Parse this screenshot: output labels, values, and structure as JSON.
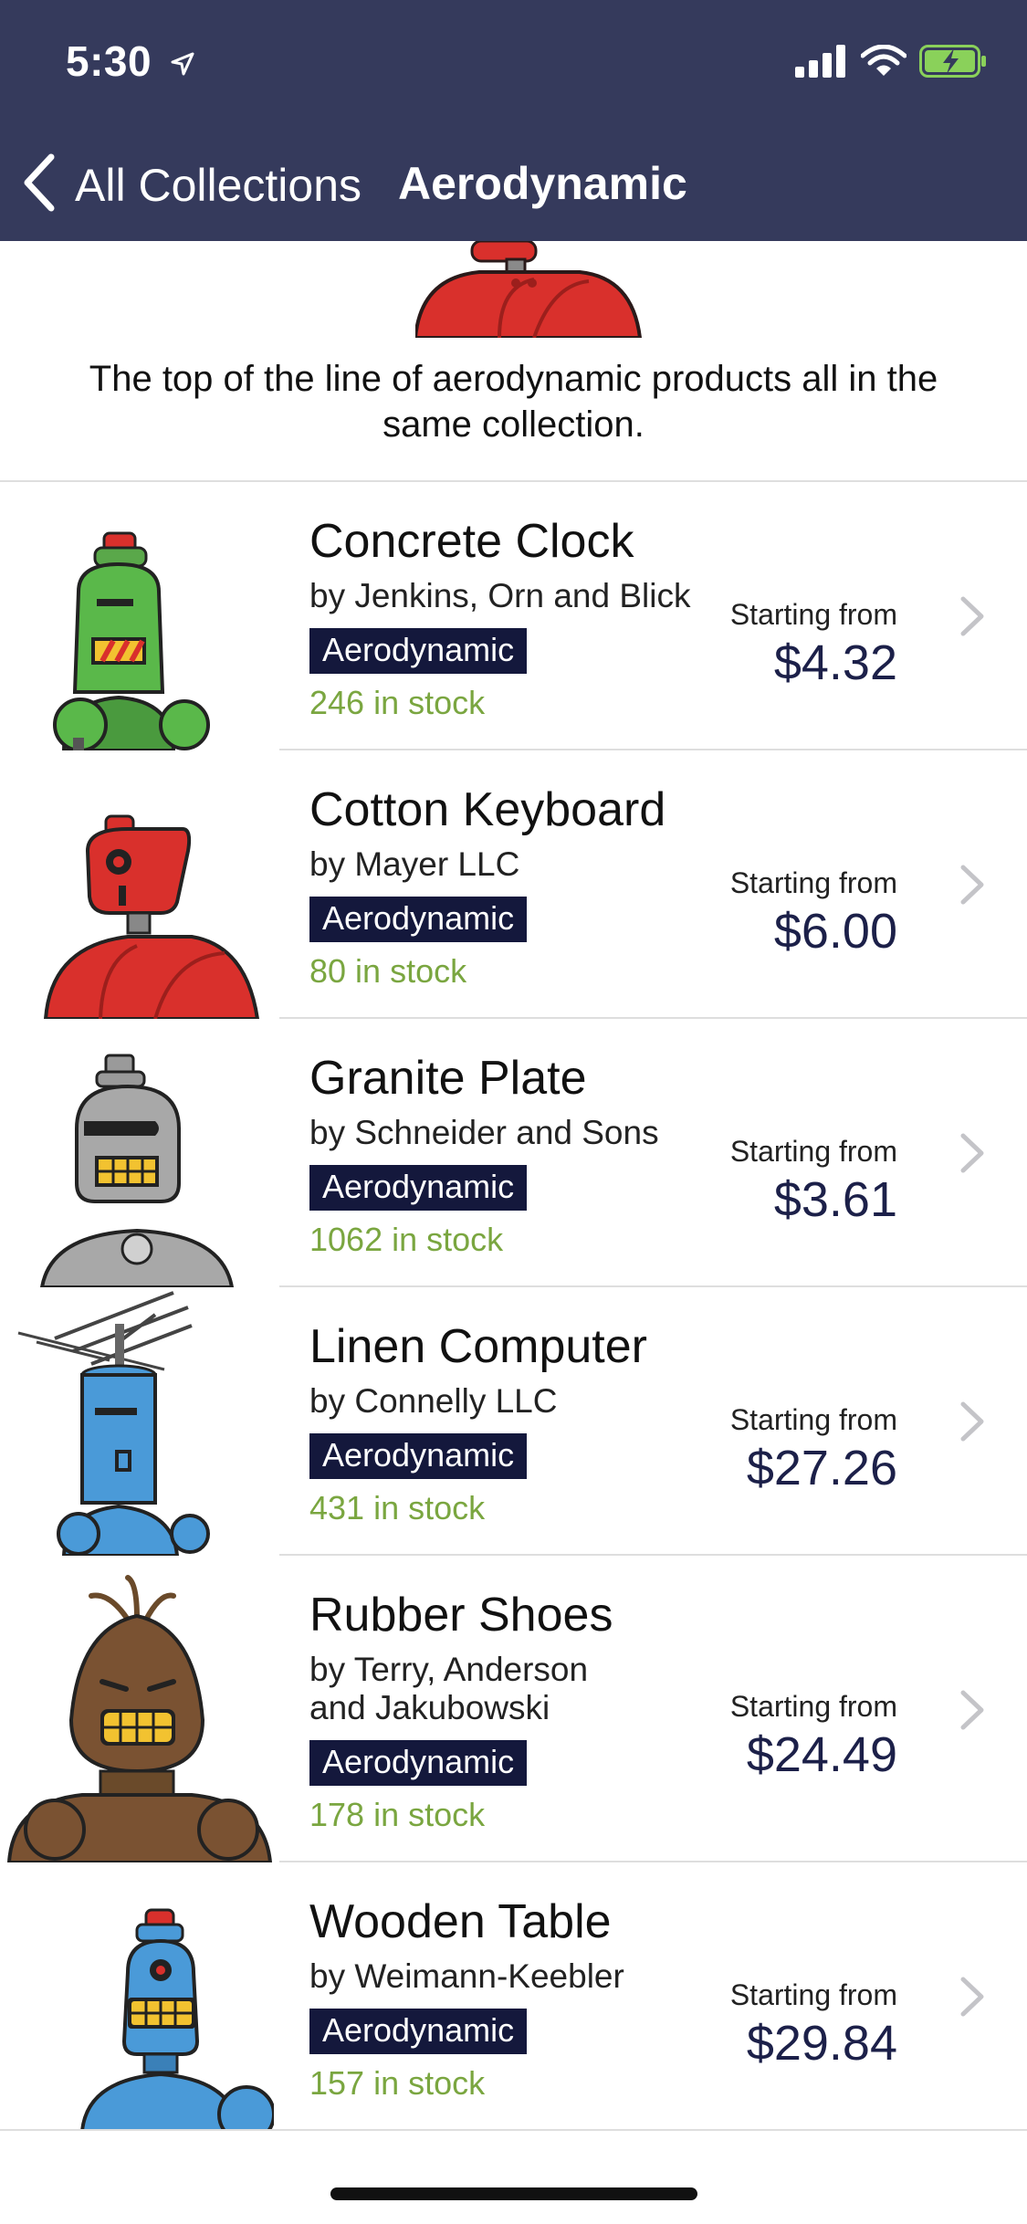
{
  "status_bar": {
    "time": "5:30",
    "icons": [
      "location-arrow-icon",
      "cellular-signal-icon",
      "wifi-icon",
      "battery-charging-icon"
    ]
  },
  "nav": {
    "back_label": "All Collections",
    "title": "Aerodynamic"
  },
  "collection": {
    "description": "The top of the line of aerodynamic products all in the same collection."
  },
  "colors": {
    "nav_background": "#353a5c",
    "tag_background": "#14183c",
    "stock_text": "#7aa640",
    "price_text": "#1c2049"
  },
  "products": [
    {
      "name": "Concrete Clock",
      "vendor": "by Jenkins, Orn and Blick",
      "tag": "Aerodynamic",
      "stock": "246 in stock",
      "price_label": "Starting from",
      "price": "$4.32",
      "robot_color": "green"
    },
    {
      "name": "Cotton Keyboard",
      "vendor": "by Mayer LLC",
      "tag": "Aerodynamic",
      "stock": "80 in stock",
      "price_label": "Starting from",
      "price": "$6.00",
      "robot_color": "red"
    },
    {
      "name": "Granite Plate",
      "vendor": "by Schneider and Sons",
      "tag": "Aerodynamic",
      "stock": "1062 in stock",
      "price_label": "Starting from",
      "price": "$3.61",
      "robot_color": "gray"
    },
    {
      "name": "Linen Computer",
      "vendor": "by Connelly LLC",
      "tag": "Aerodynamic",
      "stock": "431 in stock",
      "price_label": "Starting from",
      "price": "$27.26",
      "robot_color": "blue"
    },
    {
      "name": "Rubber Shoes",
      "vendor": "by Terry, Anderson and Jakubowski",
      "tag": "Aerodynamic",
      "stock": "178 in stock",
      "price_label": "Starting from",
      "price": "$24.49",
      "robot_color": "brown"
    },
    {
      "name": "Wooden Table",
      "vendor": "by Weimann-Keebler",
      "tag": "Aerodynamic",
      "stock": "157 in stock",
      "price_label": "Starting from",
      "price": "$29.84",
      "robot_color": "blue"
    }
  ]
}
